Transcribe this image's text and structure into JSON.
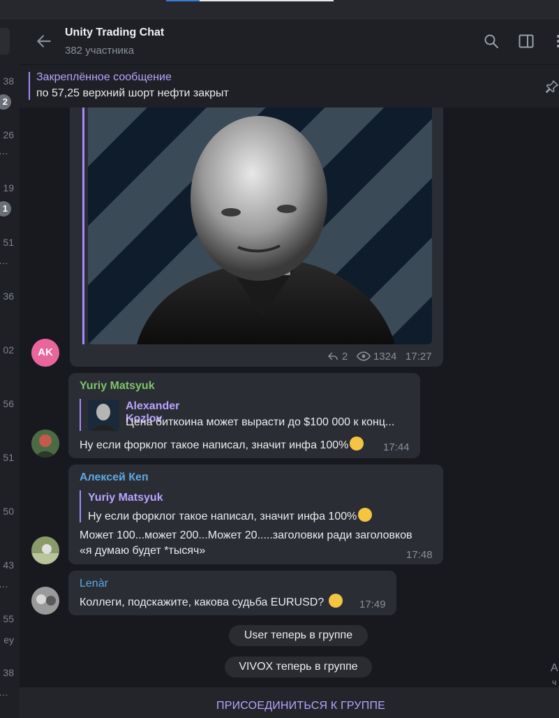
{
  "header": {
    "title": "Unity Trading Chat",
    "subtitle": "382 участника"
  },
  "pinned": {
    "title": "Закреплённое сообщение",
    "text": "по 57,25 верхний шорт нефти закрыт"
  },
  "left_list": {
    "times": [
      "38",
      "26",
      "19",
      "51",
      "36",
      "02",
      "56",
      "51",
      "50",
      "43",
      "55",
      "38"
    ],
    "badges": [
      "2",
      "1"
    ],
    "fragment": "ey"
  },
  "messages": [
    {
      "avatar_initials": "AK",
      "avatar_color": "#e8669a",
      "replies": "2",
      "views": "1324",
      "time": "17:27"
    },
    {
      "sender": "Yuriy Matsyuk",
      "sender_color": "#7fc36b",
      "quote_name": "Alexander Kozlov",
      "quote_text": "Цена биткоина может вырасти до $100 000 к конц...",
      "text": "Ну если форклог такое написал, значит инфа 100%",
      "time": "17:44"
    },
    {
      "sender": "Алексей Кеп",
      "sender_color": "#5aa9e6",
      "quote_name": "Yuriy Matsyuk",
      "quote_text": "Ну если форклог такое написал, значит инфа 100%",
      "text_line1": "Может 100...может 200...Может 20.....заголовки ради заголовков",
      "text_line2": "«я думаю будет *тысяч»",
      "time": "17:48"
    },
    {
      "sender": "Lenàr",
      "sender_color": "#5aa9e6",
      "text": "Коллеги, подскажите, какова судьба EURUSD?",
      "time": "17:49"
    }
  ],
  "service_messages": [
    "User теперь в группе",
    "VIVOX теперь в группе"
  ],
  "join_button": "ПРИСОЕДИНИТЬСЯ К ГРУППЕ",
  "right_edge_chars": [
    "А",
    "ч"
  ]
}
